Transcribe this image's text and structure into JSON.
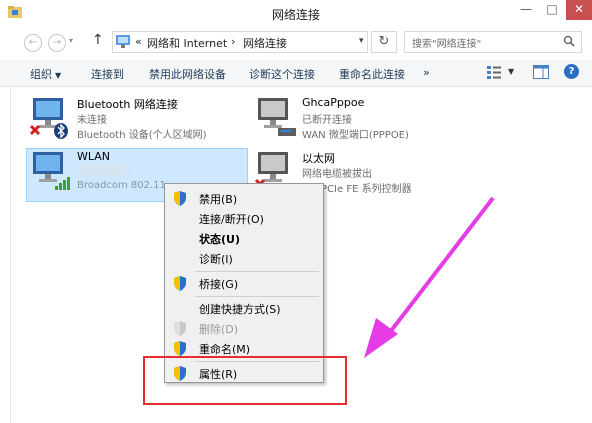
{
  "window": {
    "title": "网络连接",
    "min_glyph": "—",
    "max_glyph": "□",
    "close_glyph": "✕"
  },
  "nav": {
    "back_glyph": "←",
    "forward_glyph": "→",
    "dropdown_glyph": "▾",
    "up_glyph": "↑",
    "breadcrumbs": [
      "«",
      "网络和 Internet",
      "›",
      "网络连接"
    ],
    "refresh_glyph": "↻",
    "search_placeholder": "搜索\"网络连接\""
  },
  "toolbar": {
    "items": [
      "组织",
      "连接到",
      "禁用此网络设备",
      "诊断这个连接",
      "重命名此连接",
      "»"
    ],
    "organize_caret": "▼",
    "view_caret": "▼",
    "help_glyph": "?"
  },
  "adapters": [
    {
      "name": "Bluetooth 网络连接",
      "status": "未连接",
      "device": "Bluetooth 设备(个人区域网)",
      "icon": "bluetooth-adapter-icon"
    },
    {
      "name": "GhcaPppoe",
      "status": "已断开连接",
      "device": "WAN 微型端口(PPPOE)",
      "icon": "wan-adapter-icon"
    },
    {
      "name": "WLAN",
      "status": "",
      "device": "Broadcom 802.11",
      "icon": "wifi-adapter-icon"
    },
    {
      "name": "以太网",
      "status": "网络电缆被拔出",
      "device": "tek PCIe FE 系列控制器",
      "icon": "ethernet-adapter-icon"
    }
  ],
  "context_menu": {
    "items": [
      {
        "label": "禁用(B)",
        "shield": true,
        "style": "normal"
      },
      {
        "label": "连接/断开(O)",
        "shield": false,
        "style": "normal"
      },
      {
        "label": "状态(U)",
        "shield": false,
        "style": "bold"
      },
      {
        "label": "诊断(I)",
        "shield": false,
        "style": "normal"
      },
      {
        "label": "桥接(G)",
        "shield": true,
        "style": "normal"
      },
      {
        "label": "创建快捷方式(S)",
        "shield": false,
        "style": "normal"
      },
      {
        "label": "删除(D)",
        "shield": true,
        "style": "disabled"
      },
      {
        "label": "重命名(M)",
        "shield": true,
        "style": "normal"
      },
      {
        "label": "属性(R)",
        "shield": true,
        "style": "normal"
      }
    ]
  },
  "colors": {
    "annotation_box": "#e62e2e",
    "annotation_arrow": "#e63ce6",
    "selection": "#cde8ff"
  }
}
